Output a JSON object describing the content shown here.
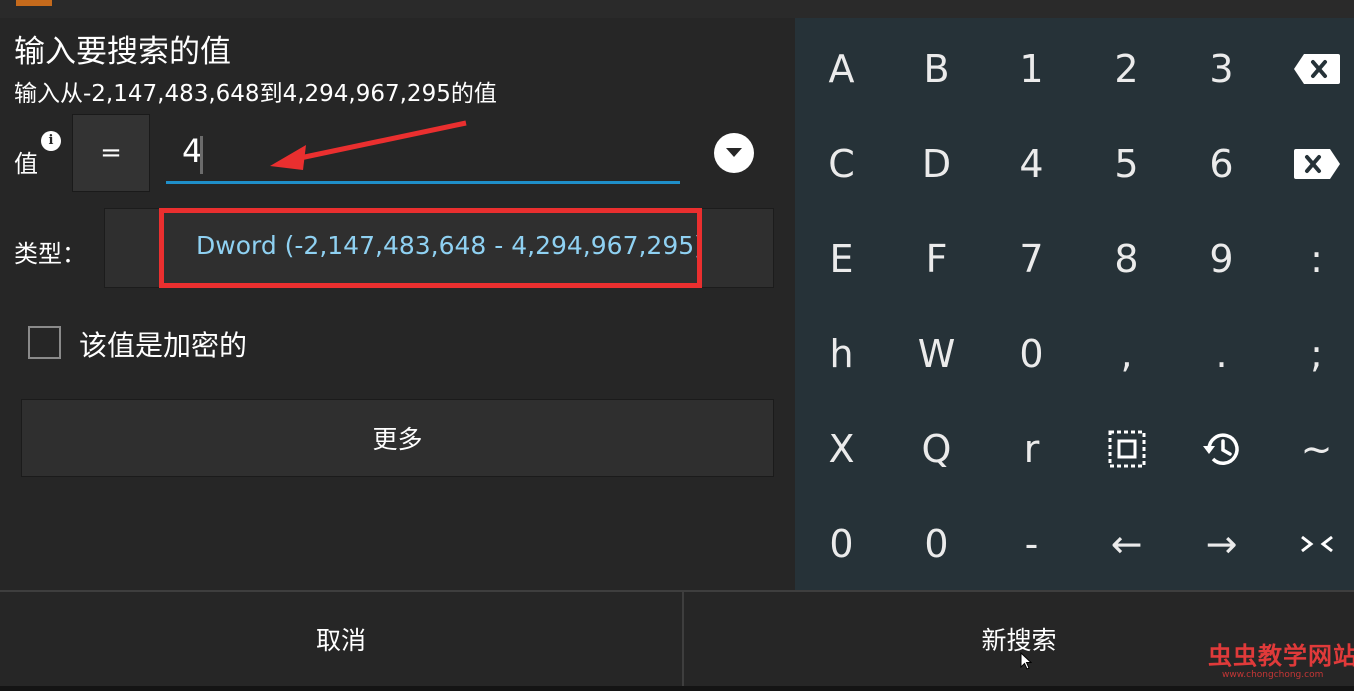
{
  "dialog": {
    "title": "输入要搜索的值",
    "subtitle": "输入从-2,147,483,648到4,294,967,295的值",
    "value_label": "值",
    "info_glyph": "i",
    "operator": "=",
    "value": "4",
    "type_label": "类型：",
    "type_value": "Dword (-2,147,483,648 - 4,294,967,295)",
    "encrypted_label": "该值是加密的",
    "encrypted_checked": false,
    "more_label": "更多"
  },
  "keypad": {
    "rows": [
      [
        "A",
        "B",
        "1",
        "2",
        "3",
        "backspace-icon"
      ],
      [
        "C",
        "D",
        "4",
        "5",
        "6",
        "clear-icon"
      ],
      [
        "E",
        "F",
        "7",
        "8",
        "9",
        ":"
      ],
      [
        "h",
        "W",
        "0",
        ",",
        ".",
        ";"
      ],
      [
        "X",
        "Q",
        "r",
        "select-all-icon",
        "history-icon",
        "~"
      ],
      [
        "0",
        "0",
        "-",
        "←",
        "→",
        "collapse-icon"
      ]
    ]
  },
  "footer": {
    "cancel_label": "取消",
    "new_search_label": "新搜索"
  },
  "watermark": {
    "text": "虫虫教学网站",
    "url": "www.chongchong.com"
  },
  "colors": {
    "accent_blue": "#1f8fc9",
    "type_text": "#8fd1f2",
    "annotation_red": "#ea2f2f",
    "keypad_bg": "#263238",
    "dialog_bg": "#262626"
  }
}
